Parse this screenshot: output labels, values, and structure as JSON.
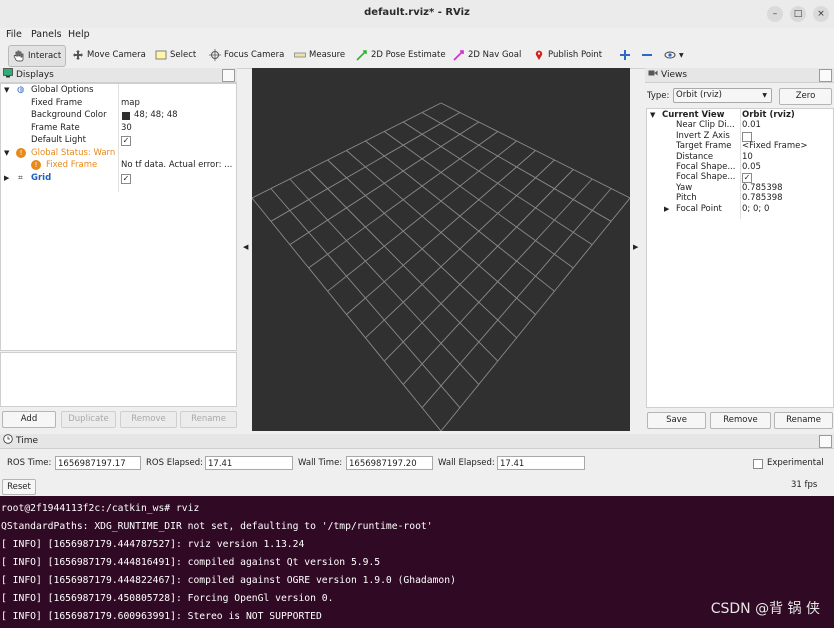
{
  "window": {
    "title": "default.rviz* - RViz",
    "minimize": "–",
    "maximize": "□",
    "close": "×"
  },
  "menu": [
    "File",
    "Panels",
    "Help"
  ],
  "toolbar": [
    {
      "label": "Interact",
      "icon": "hand-icon"
    },
    {
      "label": "Move Camera",
      "icon": "move-camera-icon"
    },
    {
      "label": "Select",
      "icon": "select-icon"
    },
    {
      "label": "Focus Camera",
      "icon": "focus-camera-icon"
    },
    {
      "label": "Measure",
      "icon": "ruler-icon"
    },
    {
      "label": "2D Pose Estimate",
      "icon": "pose-arrow-icon"
    },
    {
      "label": "2D Nav Goal",
      "icon": "nav-goal-arrow-icon"
    },
    {
      "label": "Publish Point",
      "icon": "map-pin-icon"
    }
  ],
  "displays": {
    "title": "Displays",
    "rows": [
      {
        "name": "Global Options",
        "value": ""
      },
      {
        "name": "Fixed Frame",
        "value": "map"
      },
      {
        "name": "Background Color",
        "value": "48; 48; 48"
      },
      {
        "name": "Frame Rate",
        "value": "30"
      },
      {
        "name": "Default Light",
        "value": "✓"
      },
      {
        "name": "Global Status: Warn",
        "value": ""
      },
      {
        "name": "Fixed Frame",
        "value": "No tf data.  Actual error: ..."
      },
      {
        "name": "Grid",
        "value": "✓"
      }
    ],
    "buttons": {
      "add": "Add",
      "duplicate": "Duplicate",
      "remove": "Remove",
      "rename": "Rename"
    }
  },
  "views": {
    "title": "Views",
    "type_label": "Type:",
    "type_value": "Orbit (rviz)",
    "zero_button": "Zero",
    "rows": [
      {
        "name": "Current View",
        "value": "Orbit (rviz)"
      },
      {
        "name": "Near Clip Di...",
        "value": "0.01"
      },
      {
        "name": "Invert Z Axis",
        "value": ""
      },
      {
        "name": "Target Frame",
        "value": "<Fixed Frame>"
      },
      {
        "name": "Distance",
        "value": "10"
      },
      {
        "name": "Focal Shape...",
        "value": "0.05"
      },
      {
        "name": "Focal Shape...",
        "value": "✓"
      },
      {
        "name": "Yaw",
        "value": "0.785398"
      },
      {
        "name": "Pitch",
        "value": "0.785398"
      },
      {
        "name": "Focal Point",
        "value": "0; 0; 0"
      }
    ],
    "buttons": {
      "save": "Save",
      "remove": "Remove",
      "rename": "Rename"
    }
  },
  "time": {
    "title": "Time",
    "ros_time_label": "ROS Time:",
    "ros_time": "1656987197.17",
    "ros_elapsed_label": "ROS Elapsed:",
    "ros_elapsed": "17.41",
    "wall_time_label": "Wall Time:",
    "wall_time": "1656987197.20",
    "wall_elapsed_label": "Wall Elapsed:",
    "wall_elapsed": "17.41",
    "experimental_label": "Experimental",
    "reset": "Reset",
    "fps": "31 fps"
  },
  "terminal": {
    "lines": [
      "root@2f1944113f2c:/catkin_ws# rviz",
      "QStandardPaths: XDG_RUNTIME_DIR not set, defaulting to '/tmp/runtime-root'",
      "[ INFO] [1656987179.444787527]: rviz version 1.13.24",
      "[ INFO] [1656987179.444816491]: compiled against Qt version 5.9.5",
      "[ INFO] [1656987179.444822467]: compiled against OGRE version 1.9.0 (Ghadamon)",
      "[ INFO] [1656987179.450805728]: Forcing OpenGl version 0.",
      "[ INFO] [1656987179.600963991]: Stereo is NOT SUPPORTED"
    ]
  },
  "watermark": "CSDN @背 锅 侠",
  "colors": {
    "viewport_bg": "#303030",
    "terminal_bg": "#300a24",
    "warn": "#e8891a",
    "grid_link": "#1e5fbf"
  }
}
